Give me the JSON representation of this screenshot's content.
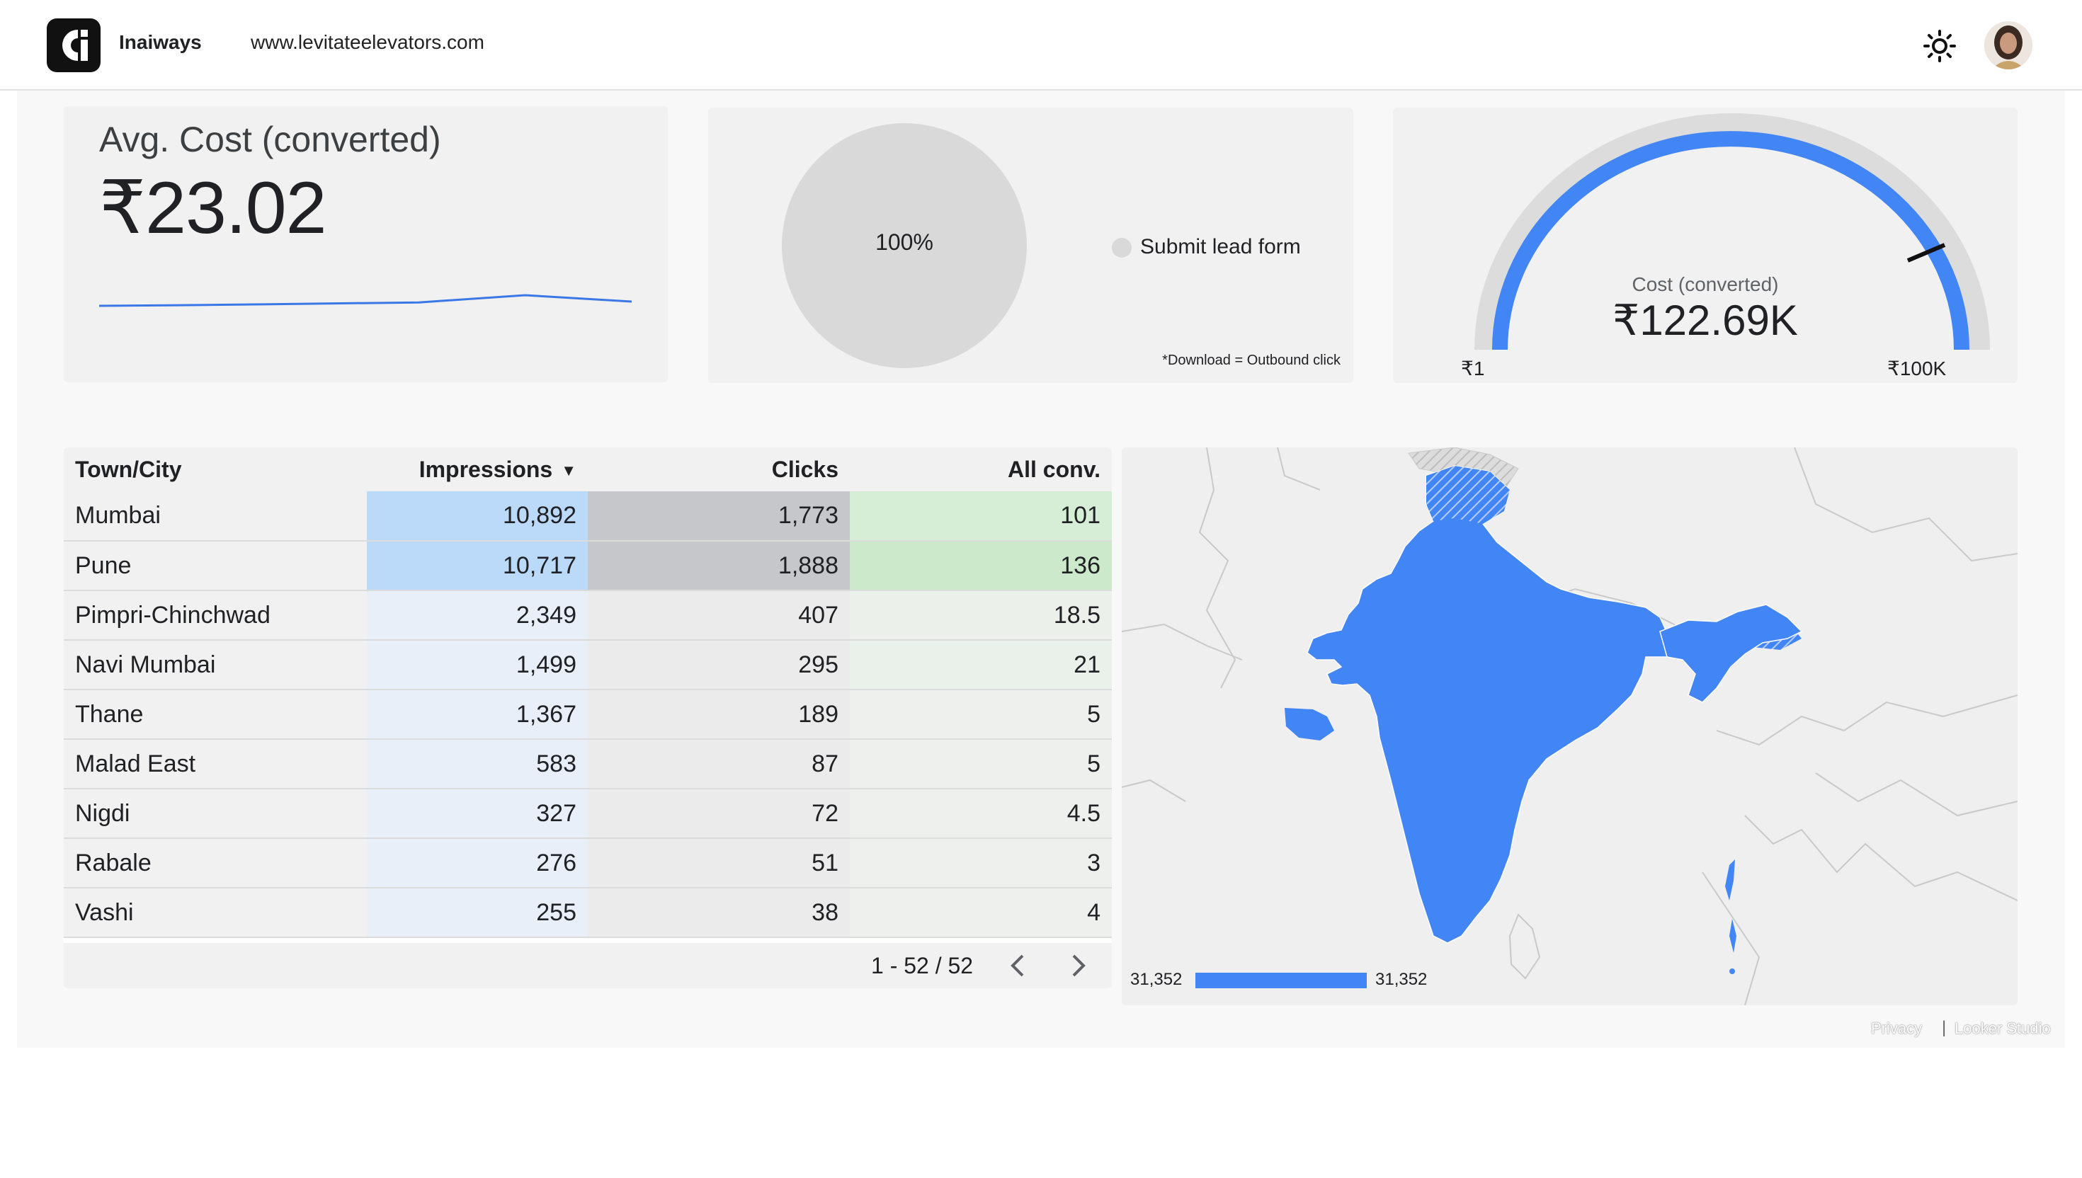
{
  "header": {
    "brand_name": "Inaiways",
    "site_url": "www.levitateelevators.com",
    "theme_icon": "sun-icon",
    "avatar_icon": "user-avatar"
  },
  "scorecard": {
    "label": "Avg. Cost (converted)",
    "value": "₹23.02",
    "sparkline": [
      0.3,
      0.32,
      0.35,
      0.38,
      0.55,
      0.4
    ]
  },
  "pie": {
    "center_label": "100%",
    "legend_label": "Submit lead form",
    "note": "*Download = Outbound click",
    "slice_color": "#d9d9d9"
  },
  "gauge": {
    "label": "Cost (converted)",
    "value": "₹122.69K",
    "min_label": "₹1",
    "max_label": "₹100K",
    "fill_color": "#4285f4"
  },
  "table": {
    "columns": [
      "Town/City",
      "Impressions",
      "Clicks",
      "All conv."
    ],
    "rows": [
      {
        "city": "Mumbai",
        "impressions": "10,892",
        "clicks": "1,773",
        "conv": "101"
      },
      {
        "city": "Pune",
        "impressions": "10,717",
        "clicks": "1,888",
        "conv": "136"
      },
      {
        "city": "Pimpri-Chinchwad",
        "impressions": "2,349",
        "clicks": "407",
        "conv": "18.5"
      },
      {
        "city": "Navi Mumbai",
        "impressions": "1,499",
        "clicks": "295",
        "conv": "21"
      },
      {
        "city": "Thane",
        "impressions": "1,367",
        "clicks": "189",
        "conv": "5"
      },
      {
        "city": "Malad East",
        "impressions": "583",
        "clicks": "87",
        "conv": "5"
      },
      {
        "city": "Nigdi",
        "impressions": "327",
        "clicks": "72",
        "conv": "4.5"
      },
      {
        "city": "Rabale",
        "impressions": "276",
        "clicks": "51",
        "conv": "3"
      },
      {
        "city": "Vashi",
        "impressions": "255",
        "clicks": "38",
        "conv": "4"
      }
    ],
    "pager_text": "1 - 52 / 52"
  },
  "map": {
    "legend_min": "31,352",
    "legend_max": "31,352",
    "fill_color": "#4285f4"
  },
  "footer": {
    "privacy": "Privacy",
    "separator": "|",
    "looker": "Looker Studio"
  }
}
